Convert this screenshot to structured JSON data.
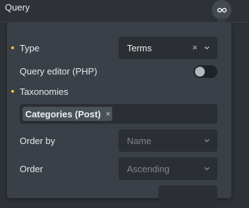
{
  "header": {
    "title": "Query",
    "link_icon": "infinity-link-icon"
  },
  "popup": {
    "type": {
      "label": "Type",
      "required": true,
      "value": "Terms",
      "clear": "×"
    },
    "query_editor": {
      "label": "Query editor (PHP)",
      "enabled": false
    },
    "taxonomies": {
      "label": "Taxonomies",
      "required": true,
      "tags": [
        {
          "label": "Categories (Post)",
          "remove": "×"
        }
      ]
    },
    "order_by": {
      "label": "Order by",
      "placeholder": "Name"
    },
    "order": {
      "label": "Order",
      "placeholder": "Ascending"
    }
  },
  "colors": {
    "required_dot": "#f6c342",
    "popup_bg": "#3a4047",
    "field_bg": "#2b2f33"
  }
}
